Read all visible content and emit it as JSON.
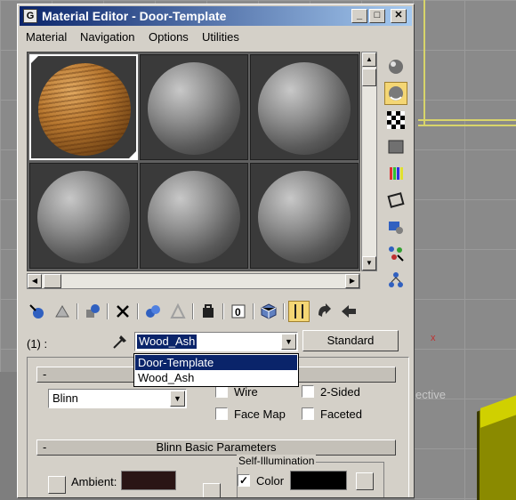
{
  "window": {
    "title": "Material Editor - Door-Template",
    "title_icon_letter": "G",
    "controls": {
      "minimize": "_",
      "maximize": "□",
      "close": "✕"
    }
  },
  "menu": [
    "Material",
    "Navigation",
    "Options",
    "Utilities"
  ],
  "sample_slots": [
    {
      "material": "wood",
      "active": true
    },
    {
      "material": "gray",
      "active": false
    },
    {
      "material": "gray",
      "active": false
    },
    {
      "material": "gray",
      "active": false
    },
    {
      "material": "gray",
      "active": false
    },
    {
      "material": "gray",
      "active": false
    }
  ],
  "side_toolbar": [
    "sample-type-sphere-icon",
    "backlight-icon",
    "background-checker-icon",
    "sample-uv-tiling-icon",
    "video-color-check-icon",
    "make-preview-icon",
    "options-icon",
    "select-by-material-icon",
    "material-map-navigator-icon"
  ],
  "side_toolbar_pressed": 1,
  "bottom_toolbar": [
    "get-material-icon",
    "put-material-to-scene-icon",
    "assign-material-to-selection-icon",
    "reset-map-icon",
    "make-material-copy-icon",
    "make-unique-icon",
    "put-to-library-icon",
    "material-effects-channel-icon",
    "show-map-in-viewport-icon",
    "show-end-result-icon",
    "go-to-parent-icon",
    "go-forward-to-sibling-icon"
  ],
  "name_row": {
    "slot_label": "(1) :",
    "material_name": "Wood_Ash",
    "type_button": "Standard"
  },
  "name_dropdown": {
    "options": [
      "Door-Template",
      "Wood_Ash"
    ],
    "highlighted": "Door-Template"
  },
  "shader_rollout": {
    "collapse": "-",
    "shader": "Blinn",
    "checkboxes": [
      {
        "label": "Wire",
        "checked": false
      },
      {
        "label": "2-Sided",
        "checked": false
      },
      {
        "label": "Face Map",
        "checked": false
      },
      {
        "label": "Faceted",
        "checked": false
      }
    ]
  },
  "blinn_rollout": {
    "collapse": "-",
    "title": "Blinn Basic Parameters",
    "ambient_label": "Ambient:",
    "ambient_color": "#2a1515",
    "self_illum_label": "Self-Illumination",
    "color_label": "Color",
    "color_checked": true,
    "self_illum_color": "#000000"
  },
  "viewport": {
    "label": "ective",
    "mark": "x"
  }
}
